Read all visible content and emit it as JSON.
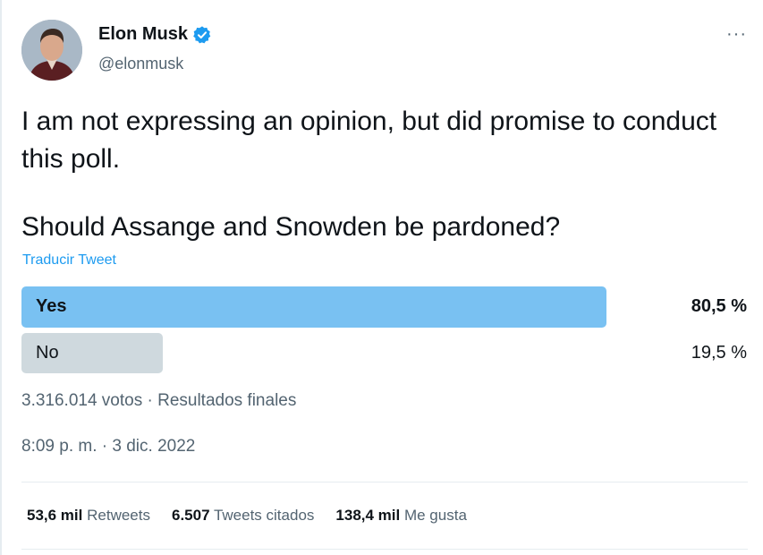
{
  "author": {
    "display_name": "Elon Musk",
    "handle": "@elonmusk",
    "verified": true,
    "verified_color": "#1d9bf0"
  },
  "more_label": "···",
  "tweet": {
    "text": "I am not expressing an opinion, but did promise to conduct this poll.",
    "question": "Should Assange and Snowden be pardoned?",
    "translate_label": "Traducir Tweet"
  },
  "poll": {
    "options": [
      {
        "label": "Yes",
        "percent": "80,5 %",
        "share": 0.805,
        "winner": true,
        "color": "#79c1f2"
      },
      {
        "label": "No",
        "percent": "19,5 %",
        "share": 0.195,
        "winner": false,
        "color": "#cfd9de"
      }
    ],
    "meta": "3.316.014 votos · Resultados finales"
  },
  "timestamp": "8:09 p. m. · 3 dic. 2022",
  "stats": [
    {
      "count": "53,6 mil",
      "label": "Retweets"
    },
    {
      "count": "6.507",
      "label": "Tweets citados"
    },
    {
      "count": "138,4 mil",
      "label": "Me gusta"
    }
  ]
}
